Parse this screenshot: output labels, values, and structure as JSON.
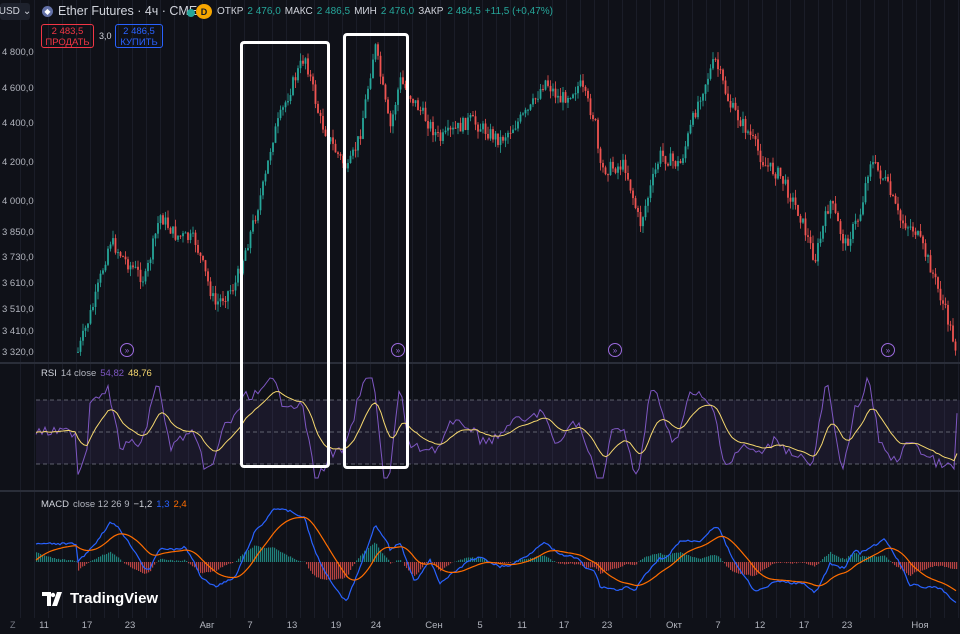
{
  "header": {
    "currency": "USD",
    "symbol": "Ether Futures · 4ч · CME",
    "badge": "D",
    "open_label": "ОТКР",
    "open": "2 476,0",
    "high_label": "МАКС",
    "high": "2 486,5",
    "low_label": "МИН",
    "low": "2 476,0",
    "close_label": "ЗАКР",
    "close": "2 484,5",
    "change": "+11,5 (+0,47%)"
  },
  "trade": {
    "sell_price": "2 483,5",
    "sell_label": "ПРОДАТЬ",
    "spread": "3,0",
    "buy_price": "2 486,5",
    "buy_label": "КУПИТЬ"
  },
  "price_axis": [
    "4 800,0",
    "4 600,0",
    "4 400,0",
    "4 200,0",
    "4 000,0",
    "3 850,0",
    "3 730,0",
    "3 610,0",
    "3 510,0",
    "3 410,0",
    "3 320,0"
  ],
  "rsi": {
    "name": "RSI",
    "params": "14 close",
    "value1": "54,82",
    "value2": "48,76"
  },
  "macd": {
    "name": "MACD",
    "params": "close 12 26 9",
    "value1": "−1,2",
    "value2": "1,3",
    "value3": "2,4"
  },
  "time_axis": [
    "11",
    "17",
    "23",
    "Авг",
    "7",
    "13",
    "19",
    "24",
    "Сен",
    "5",
    "11",
    "17",
    "23",
    "Окт",
    "7",
    "12",
    "17",
    "23",
    "Ноя"
  ],
  "logo": "TradingView",
  "z_label": "Z",
  "colors": {
    "up": "#26a69a",
    "down": "#ef5350",
    "rsi": "#7e57c2",
    "rsi_ma": "#f5d76e",
    "macd": "#2962ff",
    "signal": "#ff6d00"
  },
  "icons": [
    "chevron-down-icon",
    "eth-icon",
    "event-arrow-icon"
  ]
}
